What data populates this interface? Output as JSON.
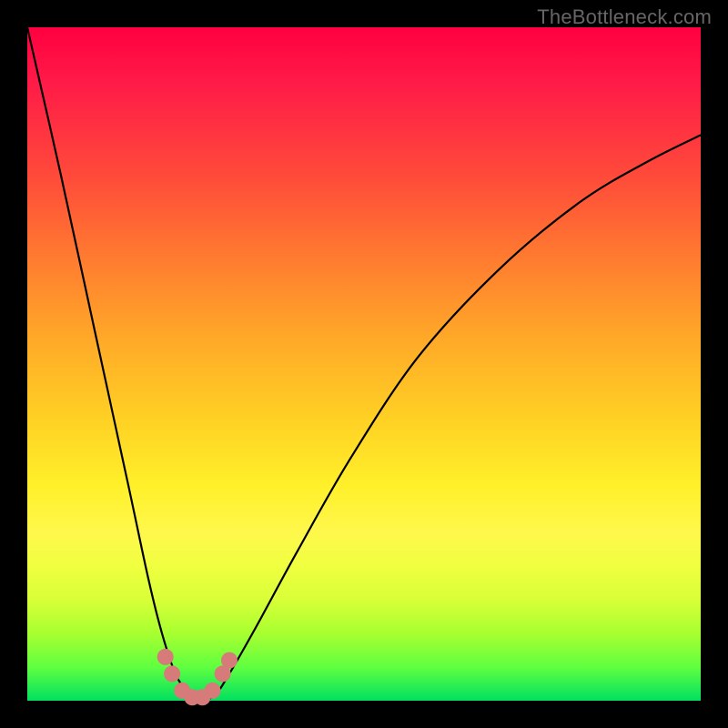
{
  "watermark": "TheBottleneck.com",
  "chart_data": {
    "type": "line",
    "title": "",
    "xlabel": "",
    "ylabel": "",
    "xlim": [
      0,
      100
    ],
    "ylim": [
      0,
      100
    ],
    "gradient_bands": [
      "red",
      "orange",
      "yellow",
      "green"
    ],
    "series": [
      {
        "name": "bottleneck-curve",
        "x": [
          0,
          5,
          10,
          15,
          18,
          20,
          22,
          24,
          26,
          28,
          30,
          34,
          40,
          48,
          58,
          70,
          82,
          92,
          100
        ],
        "values": [
          100,
          78,
          55,
          32,
          18,
          10,
          4,
          1,
          0,
          1,
          4,
          11,
          22,
          36,
          51,
          64,
          74,
          80,
          84
        ]
      }
    ],
    "markers": {
      "name": "trough-highlight",
      "color": "#d67a7a",
      "points": [
        {
          "x": 20.5,
          "y": 6.5
        },
        {
          "x": 21.5,
          "y": 4.0
        },
        {
          "x": 23.0,
          "y": 1.5
        },
        {
          "x": 24.5,
          "y": 0.5
        },
        {
          "x": 26.0,
          "y": 0.5
        },
        {
          "x": 27.5,
          "y": 1.5
        },
        {
          "x": 29.0,
          "y": 4.0
        },
        {
          "x": 30.0,
          "y": 6.0
        }
      ]
    }
  }
}
